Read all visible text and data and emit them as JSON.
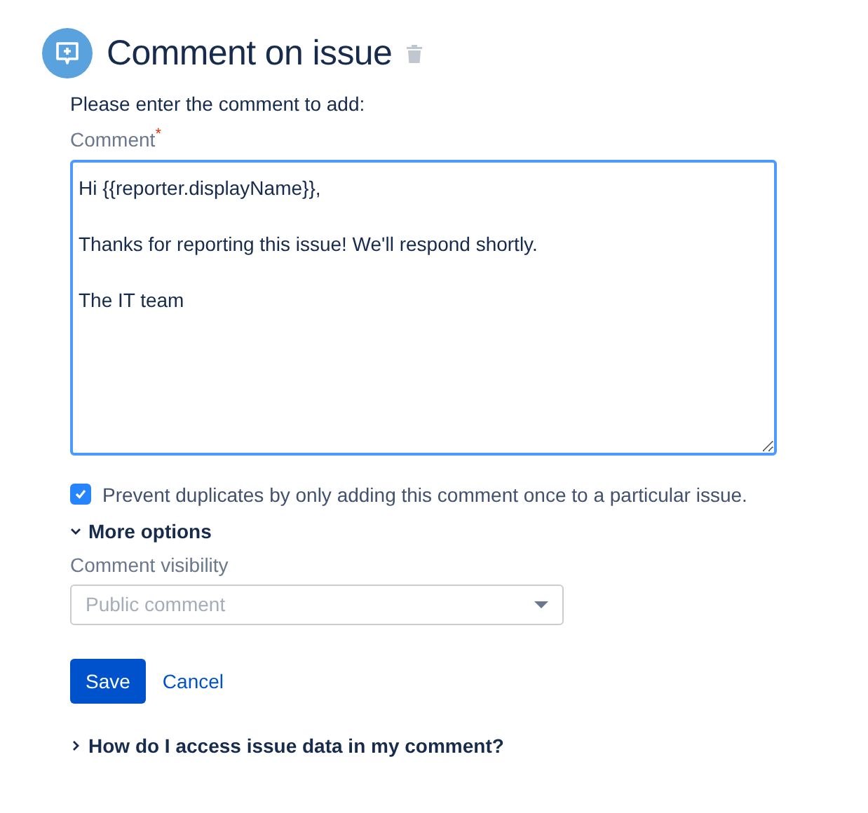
{
  "header": {
    "title": "Comment on issue"
  },
  "form": {
    "intro": "Please enter the comment to add:",
    "comment_label": "Comment",
    "required_mark": "*",
    "comment_value": "Hi {{reporter.displayName}},\n\nThanks for reporting this issue! We'll respond shortly.\n\nThe IT team",
    "prevent_duplicates": {
      "label": "Prevent duplicates by only adding this comment once to a particular issue.",
      "checked": true
    },
    "more_options": {
      "label": "More options",
      "expanded": true
    },
    "visibility_label": "Comment visibility",
    "visibility_select": {
      "placeholder": "Public comment"
    },
    "buttons": {
      "save": "Save",
      "cancel": "Cancel"
    },
    "help": {
      "label": "How do I access issue data in my comment?",
      "expanded": false
    }
  }
}
